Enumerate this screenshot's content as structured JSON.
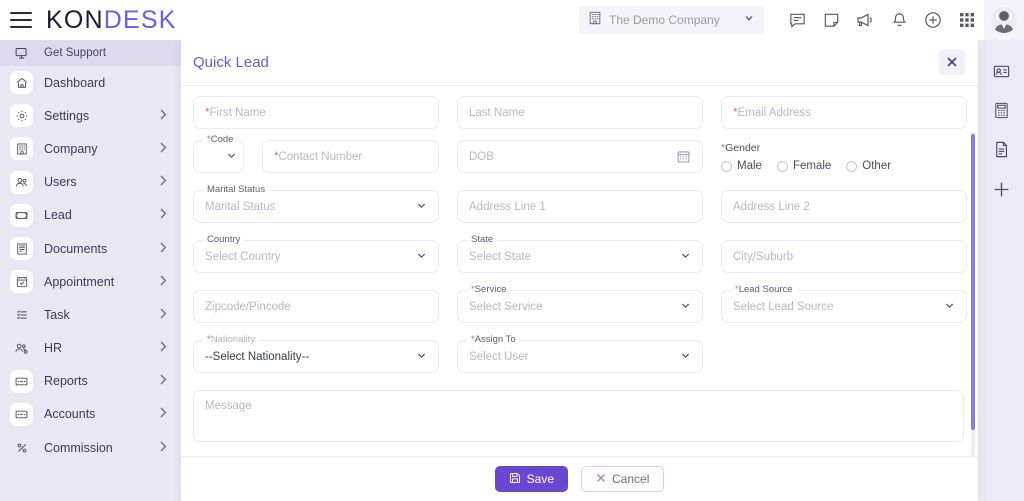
{
  "topbar": {
    "brand_kon": "KON",
    "brand_desk": "DESK",
    "company": {
      "name": "The Demo Company",
      "icon": "building-icon",
      "caret": "chevron-down-icon"
    },
    "icons": [
      {
        "name": "chat-icon"
      },
      {
        "name": "note-icon"
      },
      {
        "name": "megaphone-icon"
      },
      {
        "name": "bell-icon"
      },
      {
        "name": "plus-circle-icon"
      },
      {
        "name": "grid-apps-icon"
      }
    ],
    "avatar_name": "user-avatar"
  },
  "sidebar": {
    "items": [
      {
        "label": "Get Support",
        "icon": "support-screen-icon",
        "chevron": false,
        "active": true
      },
      {
        "label": "Dashboard",
        "icon": "home-icon",
        "chevron": false
      },
      {
        "label": "Settings",
        "icon": "gear-icon",
        "chevron": true
      },
      {
        "label": "Company",
        "icon": "building-icon",
        "chevron": true
      },
      {
        "label": "Users",
        "icon": "users-icon",
        "chevron": true
      },
      {
        "label": "Lead",
        "icon": "lead-card-icon",
        "chevron": true
      },
      {
        "label": "Documents",
        "icon": "documents-icon",
        "chevron": true
      },
      {
        "label": "Appointment",
        "icon": "calendar-check-icon",
        "chevron": true
      },
      {
        "label": "Task",
        "icon": "task-list-icon",
        "chevron": true
      },
      {
        "label": "HR",
        "icon": "hr-people-icon",
        "chevron": true
      },
      {
        "label": "Reports",
        "icon": "report-icon",
        "chevron": true
      },
      {
        "label": "Accounts",
        "icon": "accounts-icon",
        "chevron": true
      },
      {
        "label": "Commission",
        "icon": "percent-icon",
        "chevron": true
      }
    ]
  },
  "rightrail": {
    "items": [
      {
        "name": "contact-card-icon"
      },
      {
        "name": "calculator-icon"
      },
      {
        "name": "document-icon"
      },
      {
        "name": "add-plus-icon"
      }
    ]
  },
  "modal": {
    "title": "Quick Lead",
    "close_icon": "close-icon",
    "fields": {
      "first_name": {
        "placeholder": "First Name",
        "required": true
      },
      "last_name": {
        "placeholder": "Last Name",
        "required": false
      },
      "email": {
        "placeholder": "Email Address",
        "required": true
      },
      "code": {
        "label": "Code",
        "required": true,
        "value": ""
      },
      "contact_number": {
        "placeholder": "Contact Number",
        "required": true
      },
      "dob": {
        "placeholder": "DOB",
        "required": false,
        "icon": "calendar-icon"
      },
      "gender": {
        "label": "Gender",
        "required": true,
        "options": [
          "Male",
          "Female",
          "Other"
        ]
      },
      "marital_status": {
        "label": "Marital Status",
        "placeholder": "Marital Status",
        "required": false
      },
      "address_line_1": {
        "placeholder": "Address Line 1",
        "required": false
      },
      "address_line_2": {
        "placeholder": "Address Line 2",
        "required": false
      },
      "country": {
        "label": "Country",
        "placeholder": "Select Country",
        "required": false
      },
      "state": {
        "label": "State",
        "placeholder": "Select State",
        "required": false
      },
      "city": {
        "placeholder": "City/Suburb",
        "required": false
      },
      "zipcode": {
        "placeholder": "Zipcode/Pincode",
        "required": false
      },
      "service": {
        "label": "Service",
        "placeholder": "Select Service",
        "required": true
      },
      "lead_source": {
        "label": "Lead Source",
        "placeholder": "Select Lead Source",
        "required": true
      },
      "nationality": {
        "label": "Nationality",
        "value": "--Select Nationality--",
        "required": true
      },
      "assign_to": {
        "label": "Assign To",
        "placeholder": "Select User",
        "required": true
      },
      "message": {
        "placeholder": "Message",
        "required": false
      }
    },
    "footer": {
      "save_label": "Save",
      "save_icon": "save-disk-icon",
      "cancel_label": "Cancel",
      "cancel_icon": "close-x-icon"
    }
  },
  "colors": {
    "accent_purple": "#6a47d0",
    "title_purple": "#6a5acd",
    "sidebar_bg": "#e9e7f4",
    "page_bg": "#eceaf6",
    "required_red": "#e06d6d",
    "cancel_border": "#f0c9d4"
  }
}
